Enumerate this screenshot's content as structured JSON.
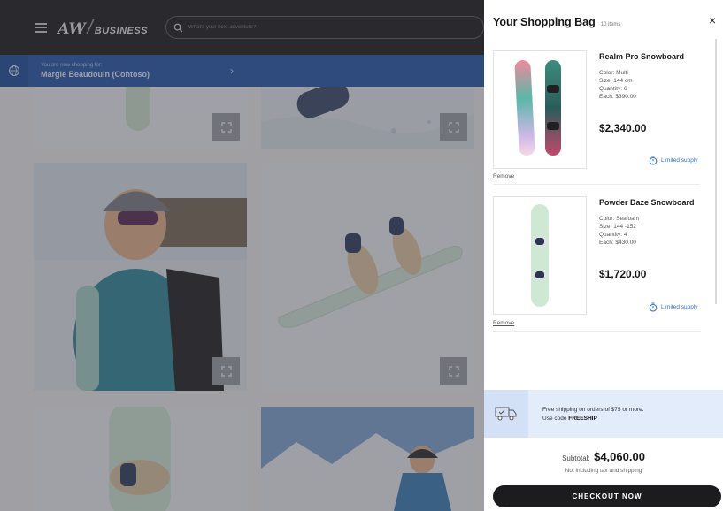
{
  "header": {
    "logo_main": "AW",
    "logo_slash": "/",
    "logo_sub": "BUSINESS",
    "search_placeholder": "What's your next adventure?",
    "menu_icon": "hamburger-icon",
    "search_icon": "search-icon"
  },
  "shipping_bar": {
    "label": "You are now shopping for:",
    "customer": "Margie Beaudouin (Contoso)",
    "icon": "globe-icon",
    "chevron": "›"
  },
  "bag": {
    "title": "Your Shopping Bag",
    "count": "10 items",
    "close": "×",
    "items": [
      {
        "name": "Realm Pro Snowboard",
        "color": "Color: Multi",
        "size": "Size: 144 cm",
        "quantity": "Quantity: 6",
        "each": "Each: $390.00",
        "price": "$2,340.00",
        "stock": "Limited supply",
        "remove": "Remove"
      },
      {
        "name": "Powder Daze Snowboard",
        "color": "Color: Seafoam",
        "size": "Size: 144 -152",
        "quantity": "Quantity: 4",
        "each": "Each: $430.00",
        "price": "$1,720.00",
        "stock": "Limited supply",
        "remove": "Remove"
      }
    ],
    "promo": {
      "line1": "Free shipping on orders of $75 or more.",
      "line2_prefix": "Use code ",
      "code": "FREESHIP",
      "icon": "truck-icon"
    },
    "subtotal_label": "Subtotal:",
    "subtotal_value": "$4,060.00",
    "subtotal_note": "Not including tax and shipping",
    "checkout_label": "CHECKOUT NOW"
  },
  "colors": {
    "topbar": "#1a1a1d",
    "shipbar": "#2557ac",
    "accent_link": "#2f6fd1",
    "checkout": "#1c1c1f",
    "promo_bg": "#e2ecfb"
  }
}
